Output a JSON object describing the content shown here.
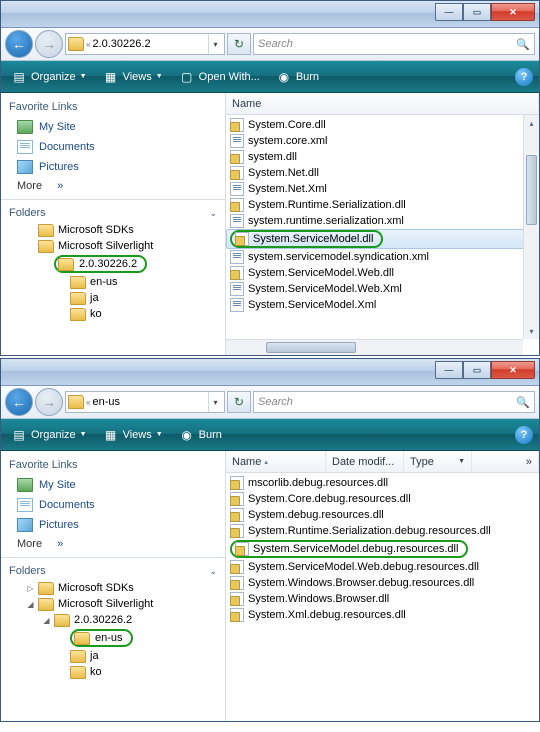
{
  "win1": {
    "breadcrumb": {
      "sep": "«",
      "folder": "2.0.30226.2"
    },
    "search_placeholder": "Search",
    "toolbar": {
      "organize": "Organize",
      "views": "Views",
      "openwith": "Open With...",
      "burn": "Burn"
    },
    "sidebar": {
      "fav_header": "Favorite Links",
      "links": [
        {
          "label": "My Site",
          "type": "fldr"
        },
        {
          "label": "Documents",
          "type": "doc"
        },
        {
          "label": "Pictures",
          "type": "pic"
        }
      ],
      "more": "More",
      "more_arrow": "»",
      "folders_header": "Folders",
      "tree": [
        {
          "label": "Microsoft SDKs",
          "indent": 1,
          "exp": ""
        },
        {
          "label": "Microsoft Silverlight",
          "indent": 1,
          "exp": ""
        },
        {
          "label": "2.0.30226.2",
          "indent": 2,
          "exp": "",
          "circled": true
        },
        {
          "label": "en-us",
          "indent": 3,
          "exp": ""
        },
        {
          "label": "ja",
          "indent": 3,
          "exp": ""
        },
        {
          "label": "ko",
          "indent": 3,
          "exp": ""
        }
      ]
    },
    "columns": {
      "name": "Name"
    },
    "files": [
      {
        "name": "System.Core.dll",
        "type": "dll"
      },
      {
        "name": "system.core.xml",
        "type": "xml"
      },
      {
        "name": "system.dll",
        "type": "dll"
      },
      {
        "name": "System.Net.dll",
        "type": "dll"
      },
      {
        "name": "System.Net.Xml",
        "type": "xml"
      },
      {
        "name": "System.Runtime.Serialization.dll",
        "type": "dll"
      },
      {
        "name": "system.runtime.serialization.xml",
        "type": "xml"
      },
      {
        "name": "System.ServiceModel.dll",
        "type": "dll",
        "circled": true,
        "selected": true
      },
      {
        "name": "system.servicemodel.syndication.xml",
        "type": "xml"
      },
      {
        "name": "System.ServiceModel.Web.dll",
        "type": "dll"
      },
      {
        "name": "System.ServiceModel.Web.Xml",
        "type": "xml"
      },
      {
        "name": "System.ServiceModel.Xml",
        "type": "xml"
      }
    ]
  },
  "win2": {
    "breadcrumb": {
      "sep": "«",
      "folder": "en-us"
    },
    "search_placeholder": "Search",
    "toolbar": {
      "organize": "Organize",
      "views": "Views",
      "burn": "Burn"
    },
    "sidebar": {
      "fav_header": "Favorite Links",
      "links": [
        {
          "label": "My Site",
          "type": "fldr"
        },
        {
          "label": "Documents",
          "type": "doc"
        },
        {
          "label": "Pictures",
          "type": "pic"
        }
      ],
      "more": "More",
      "more_arrow": "»",
      "folders_header": "Folders",
      "tree": [
        {
          "label": "Microsoft SDKs",
          "indent": 1,
          "exp": "▷"
        },
        {
          "label": "Microsoft Silverlight",
          "indent": 1,
          "exp": "◢"
        },
        {
          "label": "2.0.30226.2",
          "indent": 2,
          "exp": "◢"
        },
        {
          "label": "en-us",
          "indent": 3,
          "exp": "",
          "circled": true
        },
        {
          "label": "ja",
          "indent": 3,
          "exp": ""
        },
        {
          "label": "ko",
          "indent": 3,
          "exp": ""
        }
      ]
    },
    "columns": {
      "name": "Name",
      "date": "Date modif...",
      "type": "Type"
    },
    "more_cols": "»",
    "files": [
      {
        "name": "mscorlib.debug.resources.dll",
        "type": "dll"
      },
      {
        "name": "System.Core.debug.resources.dll",
        "type": "dll"
      },
      {
        "name": "System.debug.resources.dll",
        "type": "dll"
      },
      {
        "name": "System.Runtime.Serialization.debug.resources.dll",
        "type": "dll"
      },
      {
        "name": "System.ServiceModel.debug.resources.dll",
        "type": "dll",
        "circled": true
      },
      {
        "name": "System.ServiceModel.Web.debug.resources.dll",
        "type": "dll"
      },
      {
        "name": "System.Windows.Browser.debug.resources.dll",
        "type": "dll"
      },
      {
        "name": "System.Windows.Browser.dll",
        "type": "dll"
      },
      {
        "name": "System.Xml.debug.resources.dll",
        "type": "dll"
      }
    ]
  }
}
